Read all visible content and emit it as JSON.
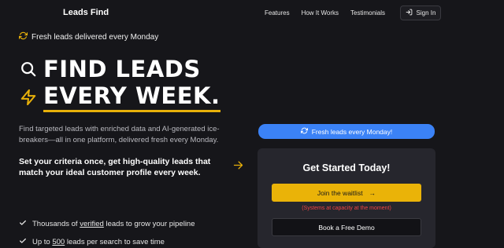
{
  "nav": {
    "logo": "Leads Find",
    "links": [
      "Features",
      "How It Works",
      "Testimonials"
    ],
    "signin_label": "Sign In"
  },
  "badge": {
    "text": "Fresh leads delivered every Monday",
    "icon": "refresh-icon"
  },
  "hero": {
    "line1": "FIND LEADS",
    "line2": "EVERY WEEK.",
    "line1_icon": "search-icon",
    "line2_icon": "lightning-icon",
    "accent_color": "#e8b10a"
  },
  "description": "Find targeted leads with enriched data and AI-generated ice-breakers—all in one platform, delivered fresh every Monday.",
  "subtext": "Set your criteria once, get high-quality leads that match your ideal customer profile every week.",
  "features": [
    {
      "prefix": "Thousands of ",
      "highlight": "verified",
      "suffix": " leads to grow your pipeline"
    },
    {
      "prefix": "Up to ",
      "highlight": "500",
      "suffix": " leads per search to save time"
    }
  ],
  "banner": {
    "text": "Fresh leads every Monday!",
    "color": "#3b82f6"
  },
  "card": {
    "title": "Get Started Today!",
    "waitlist_label": "Join the waitlist",
    "waitlist_arrow": "→",
    "capacity_note": "(Systems at capacity at the moment)",
    "demo_label": "Book a Free Demo"
  }
}
